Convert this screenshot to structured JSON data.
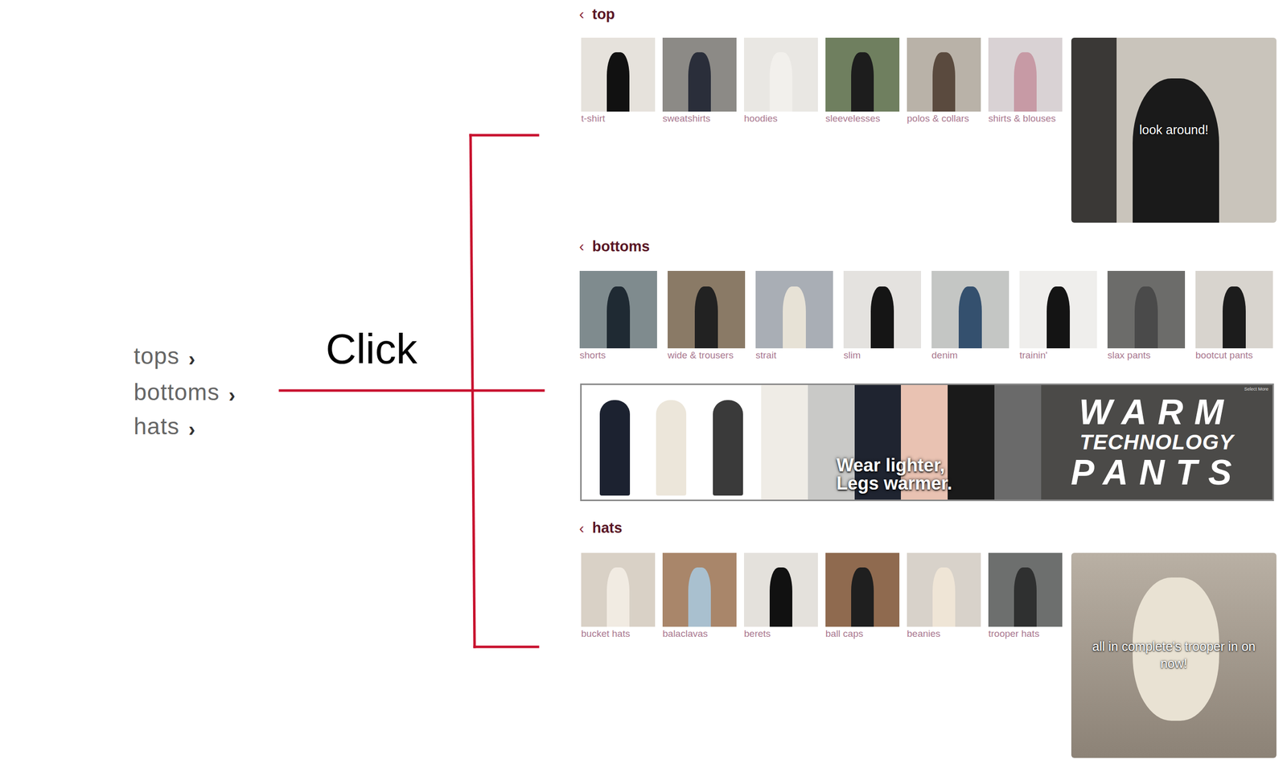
{
  "menu": [
    {
      "label": "tops",
      "arrow": "›"
    },
    {
      "label": "bottoms",
      "arrow": "›"
    },
    {
      "label": "hats",
      "arrow": "›"
    }
  ],
  "annotation": {
    "label": "Click"
  },
  "sections": [
    {
      "title": "top",
      "back": "‹",
      "items": [
        "t-shirt",
        "sweatshirts",
        "hoodies",
        "sleevelesses",
        "polos & collars",
        "shirts & blouses"
      ],
      "promo": "look around!"
    },
    {
      "title": "bottoms",
      "back": "‹",
      "items": [
        "shorts",
        "wide & trousers",
        "strait",
        "slim",
        "denim",
        "trainin'",
        "slax pants",
        "bootcut pants"
      ]
    },
    {
      "title": "hats",
      "back": "‹",
      "items": [
        "bucket hats",
        "balaclavas",
        "berets",
        "ball caps",
        "beanies",
        "trooper hats"
      ],
      "promo": "all in complete's trooper in on now!"
    }
  ],
  "banner": {
    "slogan": [
      "Wear lighter,",
      "Legs warmer."
    ],
    "headline": [
      "WARM",
      "TECHNOLOGY",
      "PANTS"
    ],
    "corner": "Select More"
  }
}
